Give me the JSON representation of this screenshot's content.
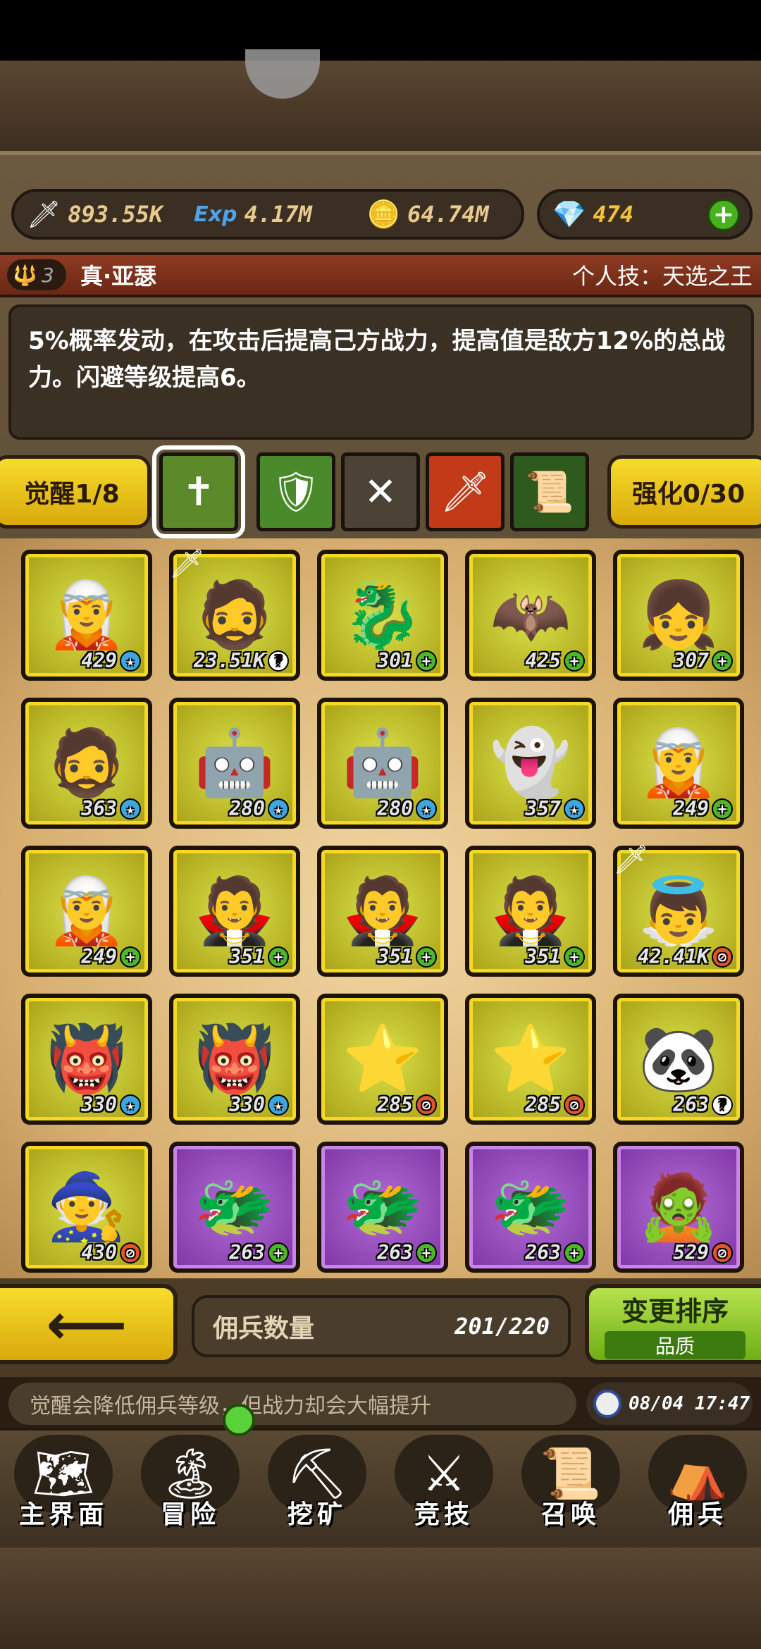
{
  "resources": {
    "attack": "893.55K",
    "exp": "4.17M",
    "gold": "64.74M",
    "gems": "474"
  },
  "skill": {
    "level": "3",
    "hero_name": "真·亚瑟",
    "skill_label": "个人技：天选之王",
    "description": "5%概率发动，在攻击后提高己方战力，提高值是敌方12%的总战力。闪避等级提高6。"
  },
  "awaken": {
    "awaken_label": "觉醒1/8",
    "enhance_label": "强化0/30",
    "slots": [
      {
        "icon": "cross-staff-icon",
        "glyph": "✝",
        "color": "#5c8a2a"
      },
      {
        "icon": "shield-up-icon",
        "glyph": "🛡",
        "color": "#4a8a2a"
      },
      {
        "icon": "empty-slot-icon",
        "glyph": "✕",
        "color": "#4c4236"
      },
      {
        "icon": "sword-icon",
        "glyph": "🗡",
        "color": "#c23a18"
      },
      {
        "icon": "scroll-icon",
        "glyph": "📜",
        "color": "#2f5a1e"
      }
    ]
  },
  "mercenaries": [
    {
      "level": "429",
      "badge": "star",
      "rarity": "gold",
      "sprite": "🧝",
      "equipped": false
    },
    {
      "level": "23.51K",
      "badge": "q",
      "rarity": "gold",
      "sprite": "🧔",
      "equipped": true
    },
    {
      "level": "301",
      "badge": "plus",
      "rarity": "gold",
      "sprite": "🐉",
      "equipped": false
    },
    {
      "level": "425",
      "badge": "plus",
      "rarity": "gold",
      "sprite": "🦇",
      "equipped": false
    },
    {
      "level": "307",
      "badge": "plus",
      "rarity": "gold",
      "sprite": "👧",
      "equipped": false
    },
    {
      "level": "363",
      "badge": "star",
      "rarity": "gold",
      "sprite": "🧔",
      "equipped": false
    },
    {
      "level": "280",
      "badge": "star",
      "rarity": "gold",
      "sprite": "🤖",
      "equipped": false
    },
    {
      "level": "280",
      "badge": "star",
      "rarity": "gold",
      "sprite": "🤖",
      "equipped": false
    },
    {
      "level": "357",
      "badge": "star",
      "rarity": "gold",
      "sprite": "👻",
      "equipped": false
    },
    {
      "level": "249",
      "badge": "plus",
      "rarity": "gold",
      "sprite": "🧝",
      "equipped": false
    },
    {
      "level": "249",
      "badge": "plus",
      "rarity": "gold",
      "sprite": "🧝",
      "equipped": false
    },
    {
      "level": "351",
      "badge": "plus",
      "rarity": "gold",
      "sprite": "🧛",
      "equipped": false
    },
    {
      "level": "351",
      "badge": "plus",
      "rarity": "gold",
      "sprite": "🧛",
      "equipped": false
    },
    {
      "level": "351",
      "badge": "plus",
      "rarity": "gold",
      "sprite": "🧛",
      "equipped": false
    },
    {
      "level": "42.41K",
      "badge": "dot",
      "rarity": "gold",
      "sprite": "👼",
      "equipped": true
    },
    {
      "level": "330",
      "badge": "star",
      "rarity": "gold",
      "sprite": "👹",
      "equipped": false
    },
    {
      "level": "330",
      "badge": "star",
      "rarity": "gold",
      "sprite": "👹",
      "equipped": false
    },
    {
      "level": "285",
      "badge": "dot",
      "rarity": "gold",
      "sprite": "⭐",
      "equipped": false
    },
    {
      "level": "285",
      "badge": "dot",
      "rarity": "gold",
      "sprite": "⭐",
      "equipped": false
    },
    {
      "level": "263",
      "badge": "q",
      "rarity": "gold",
      "sprite": "🐼",
      "equipped": false
    },
    {
      "level": "430",
      "badge": "dot",
      "rarity": "gold",
      "sprite": "🧙",
      "equipped": false
    },
    {
      "level": "263",
      "badge": "plus",
      "rarity": "purple",
      "sprite": "🐲",
      "equipped": false
    },
    {
      "level": "263",
      "badge": "plus",
      "rarity": "purple",
      "sprite": "🐲",
      "equipped": false
    },
    {
      "level": "263",
      "badge": "plus",
      "rarity": "purple",
      "sprite": "🐲",
      "equipped": false
    },
    {
      "level": "529",
      "badge": "dot",
      "rarity": "purple",
      "sprite": "🧟",
      "equipped": false
    }
  ],
  "footer": {
    "count_label": "佣兵数量",
    "count_value": "201/220",
    "sort_label": "变更排序",
    "sort_mode": "品质",
    "tip": "觉醒会降低佣兵等级，但战力却会大幅提升",
    "time": "08/04 17:47"
  },
  "nav": [
    {
      "label": "主界面",
      "icon": "map-scroll-icon",
      "glyph": "🗺"
    },
    {
      "label": "冒险",
      "icon": "island-icon",
      "glyph": "🏝"
    },
    {
      "label": "挖矿",
      "icon": "pickaxe-icon",
      "glyph": "⛏"
    },
    {
      "label": "竞技",
      "icon": "crossed-swords-icon",
      "glyph": "⚔"
    },
    {
      "label": "召唤",
      "icon": "summon-scroll-icon",
      "glyph": "📜"
    },
    {
      "label": "佣兵",
      "icon": "tent-icon",
      "glyph": "⛺"
    }
  ]
}
